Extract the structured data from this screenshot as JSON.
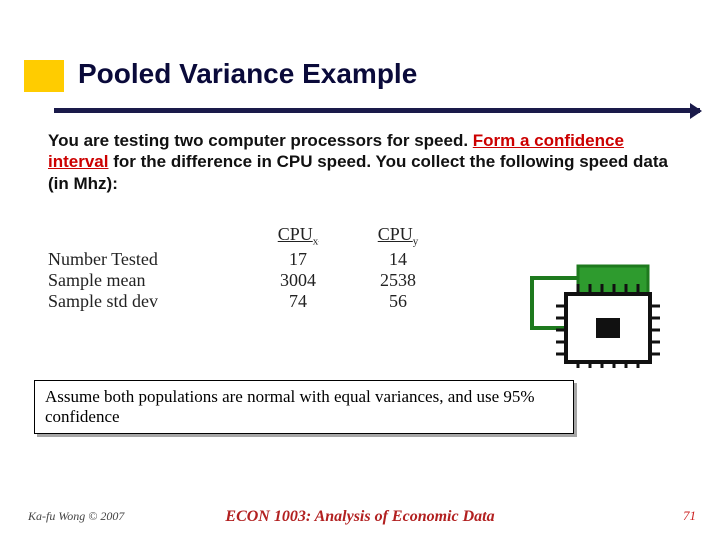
{
  "title": "Pooled Variance Example",
  "intro": {
    "t1": "You are testing two computer processors for speed. ",
    "highlight": "Form a confidence interval",
    "t2": " for the difference in CPU speed. You collect the following speed data (in Mhz):"
  },
  "table": {
    "head_c1": "CPU",
    "head_c1_sub": "x",
    "head_c2": "CPU",
    "head_c2_sub": "y",
    "rows": {
      "r1_label": "Number Tested",
      "r1_c1": "17",
      "r1_c2": "14",
      "r2_label": "Sample mean",
      "r2_c1": "3004",
      "r2_c2": "2538",
      "r3_label": "Sample std dev",
      "r3_c1": "74",
      "r3_c2": "56"
    }
  },
  "assume": "Assume both populations are normal with equal variances, and use 95% confidence",
  "footer": {
    "left": "Ka-fu Wong © 2007",
    "center": "ECON 1003: Analysis of Economic Data",
    "right": "71"
  },
  "clipart_name": "chip-icon",
  "colors": {
    "accent_yellow": "#ffcc00",
    "accent_navy": "#1a1a4a",
    "accent_red": "#cc0000",
    "chip_green": "#2e9b2e"
  }
}
